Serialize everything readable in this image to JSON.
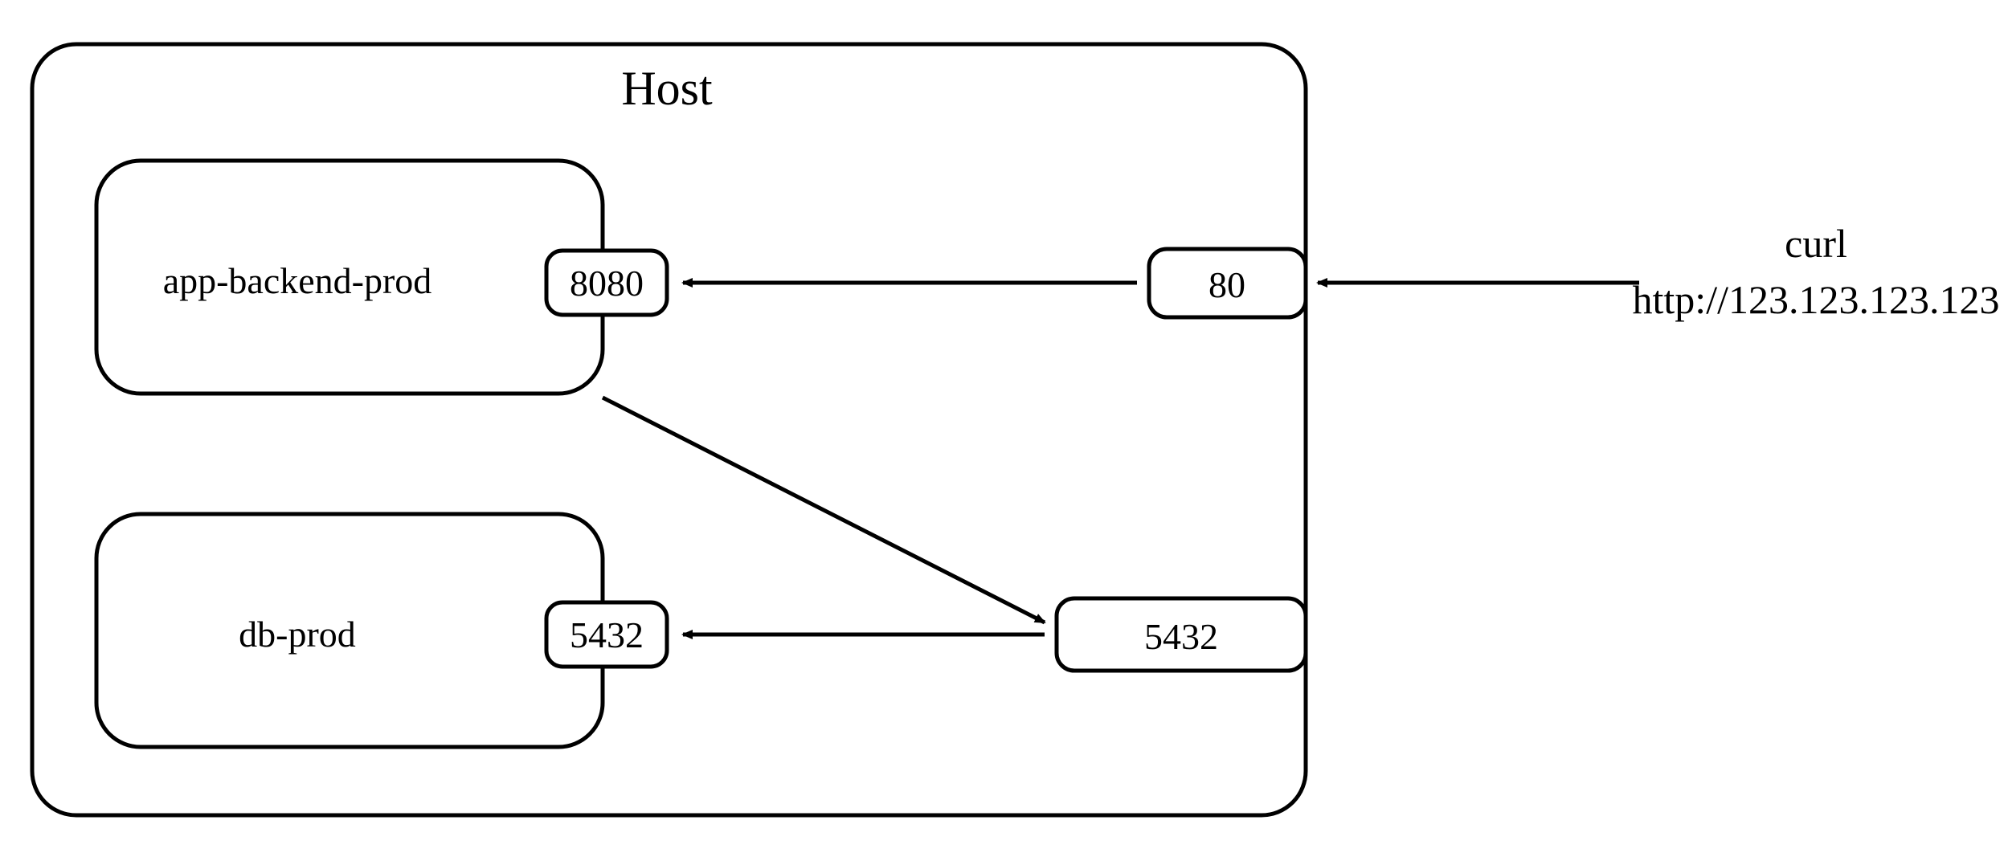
{
  "diagram": {
    "host_title": "Host",
    "containers": [
      {
        "name": "app-backend-prod",
        "port": "8080"
      },
      {
        "name": "db-prod",
        "port": "5432"
      }
    ],
    "host_ports": {
      "http": "80",
      "db": "5432"
    },
    "external_request": {
      "command": "curl",
      "url": "http://123.123.123.123"
    }
  }
}
